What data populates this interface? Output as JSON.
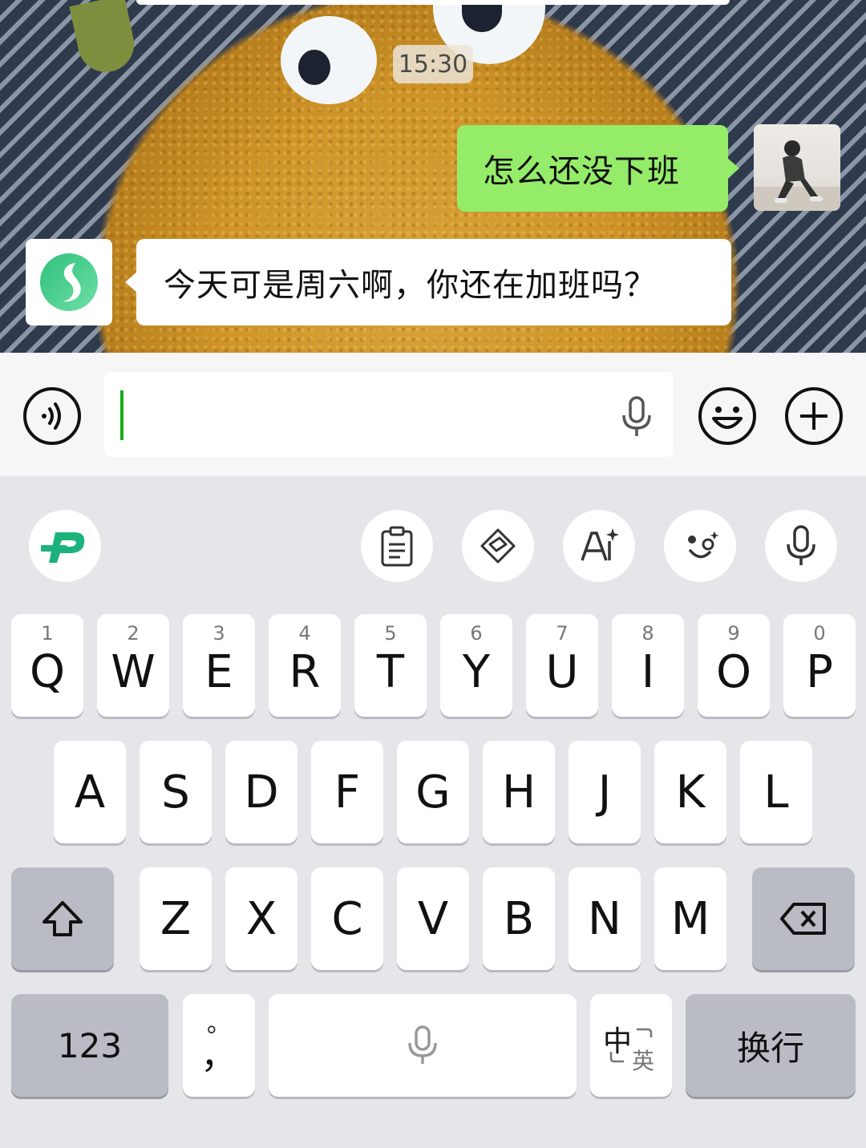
{
  "chat": {
    "timestamp": "15:30",
    "messages": [
      {
        "direction": "outgoing",
        "text": "怎么还没下班"
      },
      {
        "direction": "incoming",
        "text": "今天可是周六啊，你还在加班吗？"
      }
    ]
  },
  "input_bar": {
    "value": "",
    "icons": [
      "voice-wave-icon",
      "microphone-icon",
      "emoji-icon",
      "plus-icon"
    ]
  },
  "keyboard": {
    "toolbar_icons": [
      "ime-logo-icon",
      "clipboard-icon",
      "layers-icon",
      "ai-text-icon",
      "face-icon",
      "microphone-icon"
    ],
    "row1": [
      {
        "num": "1",
        "letter": "Q"
      },
      {
        "num": "2",
        "letter": "W"
      },
      {
        "num": "3",
        "letter": "E"
      },
      {
        "num": "4",
        "letter": "R"
      },
      {
        "num": "5",
        "letter": "T"
      },
      {
        "num": "6",
        "letter": "Y"
      },
      {
        "num": "7",
        "letter": "U"
      },
      {
        "num": "8",
        "letter": "I"
      },
      {
        "num": "9",
        "letter": "O"
      },
      {
        "num": "0",
        "letter": "P"
      }
    ],
    "row2": [
      "A",
      "S",
      "D",
      "F",
      "G",
      "H",
      "J",
      "K",
      "L"
    ],
    "row3": [
      "Z",
      "X",
      "C",
      "V",
      "B",
      "N",
      "M"
    ],
    "bottom": {
      "numbers_label": "123",
      "punct_top": "。",
      "punct_bottom": "，",
      "lang_top": "中",
      "lang_bottom": "英",
      "enter_label": "换行"
    },
    "colors": {
      "accent_green": "#95ec69",
      "brand_green": "#1bb37b"
    }
  }
}
